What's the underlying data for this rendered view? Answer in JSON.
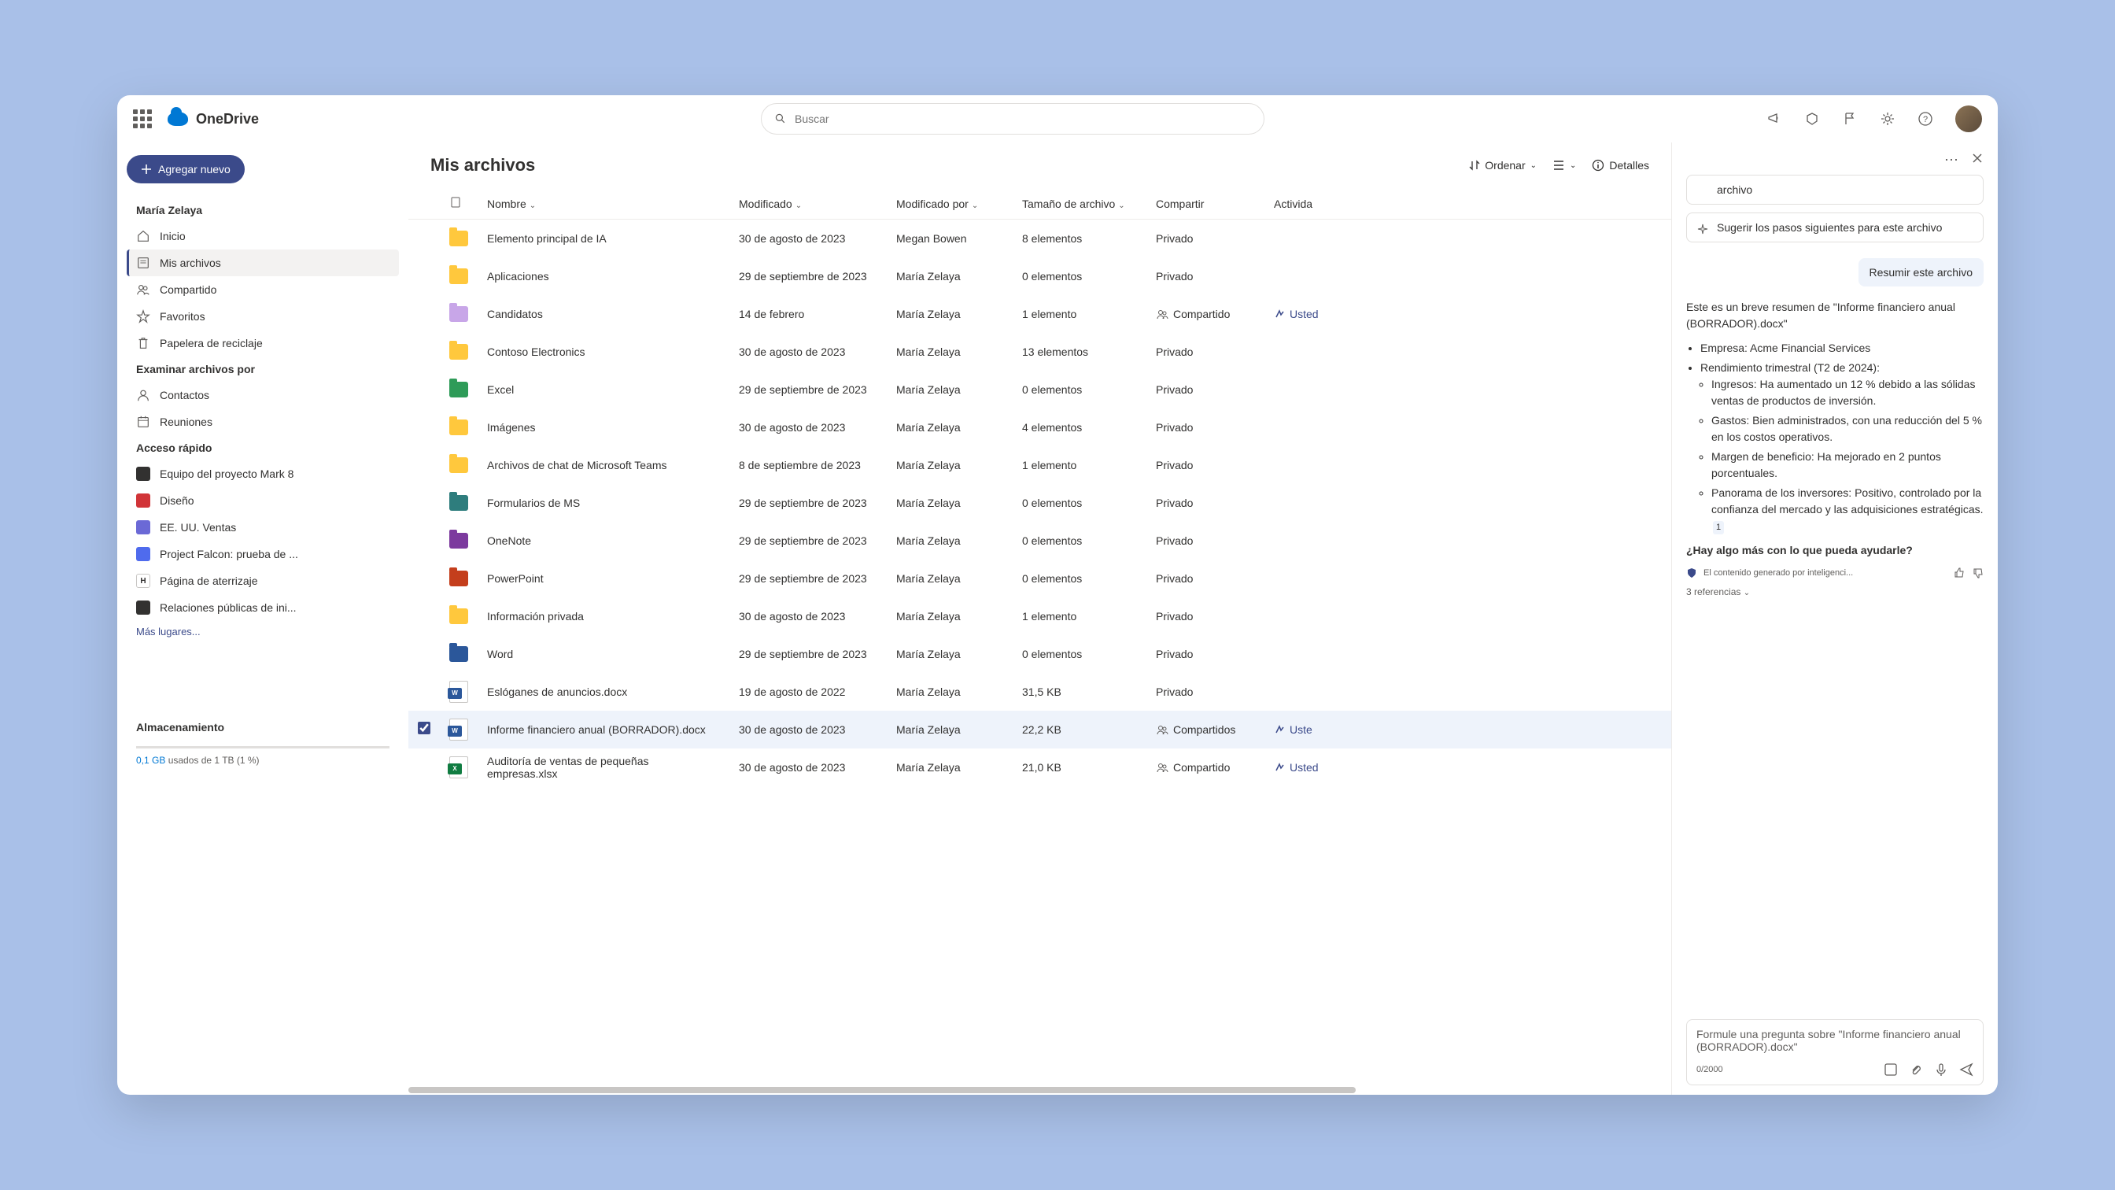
{
  "brand": "OneDrive",
  "search": {
    "placeholder": "Buscar"
  },
  "sidebar": {
    "add_label": "Agregar nuevo",
    "user": "María Zelaya",
    "nav": [
      {
        "label": "Inicio",
        "icon": "home"
      },
      {
        "label": "Mis archivos",
        "icon": "files",
        "active": true
      },
      {
        "label": "Compartido",
        "icon": "people"
      },
      {
        "label": "Favoritos",
        "icon": "star"
      },
      {
        "label": "Papelera de reciclaje",
        "icon": "trash"
      }
    ],
    "browse_title": "Examinar archivos por",
    "browse": [
      {
        "label": "Contactos",
        "icon": "person"
      },
      {
        "label": "Reuniones",
        "icon": "calendar"
      }
    ],
    "quick_title": "Acceso rápido",
    "quick": [
      {
        "label": "Equipo del proyecto Mark 8",
        "color": "#323130"
      },
      {
        "label": "Diseño",
        "color": "#d13438"
      },
      {
        "label": "EE. UU. Ventas",
        "color": "#6b69d6"
      },
      {
        "label": "Project Falcon: prueba de ...",
        "color": "#4f6bed"
      },
      {
        "label": "Página de aterrizaje",
        "color": "#ffffff"
      },
      {
        "label": "Relaciones públicas de ini...",
        "color": "#323130"
      }
    ],
    "more": "Más lugares...",
    "storage_title": "Almacenamiento",
    "storage_text_hl": "0,1 GB",
    "storage_text_rest": " usados de 1 TB (1 %)"
  },
  "main": {
    "title": "Mis archivos",
    "sort_label": "Ordenar",
    "details_label": "Detalles",
    "columns": [
      "Nombre",
      "Modificado",
      "Modificado por",
      "Tamaño de archivo",
      "Compartir",
      "Activida"
    ],
    "rows": [
      {
        "type": "folder",
        "color": "#ffc83d",
        "name": "Elemento principal de IA",
        "mod": "30 de agosto de 2023",
        "by": "Megan Bowen",
        "size": "8 elementos",
        "share": "Privado"
      },
      {
        "type": "folder",
        "color": "#ffc83d",
        "name": "Aplicaciones",
        "mod": "29 de septiembre de 2023",
        "by": "María Zelaya",
        "size": "0 elementos",
        "share": "Privado"
      },
      {
        "type": "folder",
        "color": "#c8a6e8",
        "name": "Candidatos",
        "mod": "14 de febrero",
        "by": "María Zelaya",
        "size": "1 elemento",
        "share": "Compartido",
        "shared": true,
        "act": "Usted"
      },
      {
        "type": "folder",
        "color": "#ffc83d",
        "name": "Contoso Electronics",
        "mod": "30 de agosto de 2023",
        "by": "María Zelaya",
        "size": "13 elementos",
        "share": "Privado"
      },
      {
        "type": "folder",
        "color": "#2e9b58",
        "name": "Excel",
        "mod": "29 de septiembre de 2023",
        "by": "María Zelaya",
        "size": "0 elementos",
        "share": "Privado"
      },
      {
        "type": "folder",
        "color": "#ffc83d",
        "name": "Imágenes",
        "mod": "30 de agosto de 2023",
        "by": "María Zelaya",
        "size": "4 elementos",
        "share": "Privado"
      },
      {
        "type": "folder",
        "color": "#ffc83d",
        "name": "Archivos de chat de Microsoft Teams",
        "mod": "8 de septiembre de 2023",
        "by": "María Zelaya",
        "size": "1 elemento",
        "share": "Privado"
      },
      {
        "type": "folder",
        "color": "#2e7d7d",
        "name": "Formularios de MS",
        "mod": "29 de septiembre de 2023",
        "by": "María Zelaya",
        "size": "0 elementos",
        "share": "Privado"
      },
      {
        "type": "folder",
        "color": "#7c3a9e",
        "name": "OneNote",
        "mod": "29 de septiembre de 2023",
        "by": "María Zelaya",
        "size": "0 elementos",
        "share": "Privado"
      },
      {
        "type": "folder",
        "color": "#c43e1c",
        "name": "PowerPoint",
        "mod": "29 de septiembre de 2023",
        "by": "María Zelaya",
        "size": "0 elementos",
        "share": "Privado"
      },
      {
        "type": "folder",
        "color": "#ffc83d",
        "name": "Información privada",
        "mod": "30 de agosto de 2023",
        "by": "María Zelaya",
        "size": "1 elemento",
        "share": "Privado"
      },
      {
        "type": "folder",
        "color": "#2b579a",
        "name": "Word",
        "mod": "29 de septiembre de 2023",
        "by": "María Zelaya",
        "size": "0 elementos",
        "share": "Privado"
      },
      {
        "type": "word",
        "name": "Eslóganes de anuncios.docx",
        "mod": "19 de agosto de 2022",
        "by": "María Zelaya",
        "size": "31,5 KB",
        "share": "Privado"
      },
      {
        "type": "word",
        "name": "Informe financiero anual (BORRADOR).docx",
        "mod": "30 de agosto de 2023",
        "by": "María Zelaya",
        "size": "22,2 KB",
        "share": "Compartidos",
        "shared": true,
        "selected": true,
        "act": "Uste"
      },
      {
        "type": "excel",
        "name": "Auditoría de ventas de pequeñas empresas.xlsx",
        "mod": "30 de agosto de 2023",
        "by": "María Zelaya",
        "size": "21,0 KB",
        "share": "Compartido",
        "shared": true,
        "act": "Usted"
      }
    ]
  },
  "copilot": {
    "suggest1_tail": "archivo",
    "suggest2": "Sugerir los pasos siguientes para este archivo",
    "user_msg": "Resumir este archivo",
    "intro": "Este es un breve resumen de \"Informe financiero anual (BORRADOR).docx\"",
    "b1": "Empresa: Acme Financial Services",
    "b2": "Rendimiento trimestral (T2 de 2024):",
    "s1": "Ingresos: Ha aumentado un 12 % debido a las sólidas ventas de productos de inversión.",
    "s2": "Gastos: Bien administrados, con una reducción del 5 % en los costos operativos.",
    "s3": "Margen de beneficio: Ha mejorado en 2 puntos porcentuales.",
    "s4": "Panorama de los inversores: Positivo, controlado por la confianza del mercado y las adquisiciones estratégicas.",
    "ref1": "1",
    "followup": "¿Hay algo más con lo que pueda ayudarle?",
    "ai_note": "El contenido generado por inteligenci...",
    "refs": "3 referencias",
    "input_ph": "Formule una pregunta sobre \"Informe financiero anual (BORRADOR).docx\"",
    "count": "0/2000"
  }
}
